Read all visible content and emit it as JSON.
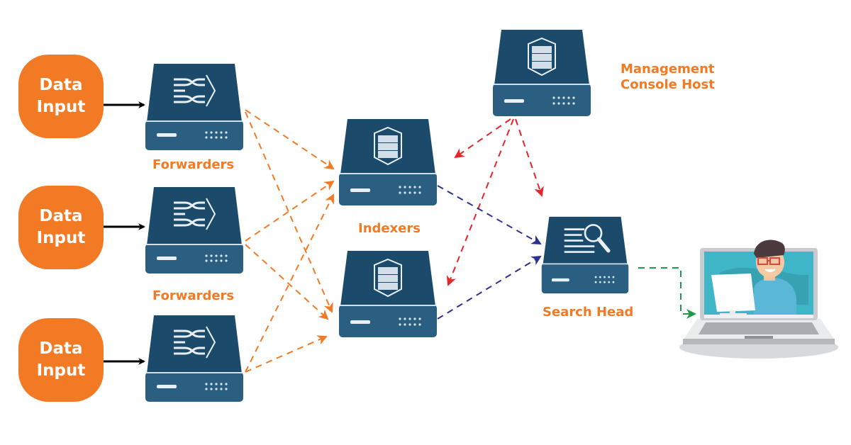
{
  "diagram": {
    "data_inputs": [
      {
        "line1": "Data",
        "line2": "Input"
      },
      {
        "line1": "Data",
        "line2": "Input"
      },
      {
        "line1": "Data",
        "line2": "Input"
      }
    ],
    "labels": {
      "forwarders_1": "Forwarders",
      "forwarders_2": "Forwarders",
      "indexers": "Indexers",
      "search_head": "Search Head",
      "management_line1": "Management",
      "management_line2": "Console Host"
    },
    "colors": {
      "accent_orange": "#f27a24",
      "server_dark": "#1b4a6b",
      "server_light": "#2a5f82",
      "arrow_black": "#000000",
      "arrow_orange": "#f27a24",
      "arrow_red": "#e8232a",
      "arrow_blue": "#2b2f8f",
      "arrow_green": "#1e9c4a"
    },
    "edges": [
      {
        "from": "data-input-1",
        "to": "forwarder-1",
        "style": "solid",
        "color": "black"
      },
      {
        "from": "data-input-2",
        "to": "forwarder-2",
        "style": "solid",
        "color": "black"
      },
      {
        "from": "data-input-3",
        "to": "forwarder-3",
        "style": "solid",
        "color": "black"
      },
      {
        "from": "forwarder-1",
        "to": "indexer-1",
        "style": "dashed",
        "color": "orange"
      },
      {
        "from": "forwarder-1",
        "to": "indexer-2",
        "style": "dashed",
        "color": "orange"
      },
      {
        "from": "forwarder-2",
        "to": "indexer-1",
        "style": "dashed",
        "color": "orange"
      },
      {
        "from": "forwarder-2",
        "to": "indexer-2",
        "style": "dashed",
        "color": "orange"
      },
      {
        "from": "forwarder-3",
        "to": "indexer-1",
        "style": "dashed",
        "color": "orange"
      },
      {
        "from": "forwarder-3",
        "to": "indexer-2",
        "style": "dashed",
        "color": "orange"
      },
      {
        "from": "management-console",
        "to": "indexer-1",
        "style": "dashed",
        "color": "red"
      },
      {
        "from": "management-console",
        "to": "indexer-2",
        "style": "dashed",
        "color": "red"
      },
      {
        "from": "management-console",
        "to": "search-head",
        "style": "dashed",
        "color": "red"
      },
      {
        "from": "indexer-1",
        "to": "search-head",
        "style": "dashed",
        "color": "blue"
      },
      {
        "from": "indexer-2",
        "to": "search-head",
        "style": "dashed",
        "color": "blue"
      },
      {
        "from": "search-head",
        "to": "user-laptop",
        "style": "dashed",
        "color": "green"
      }
    ]
  }
}
